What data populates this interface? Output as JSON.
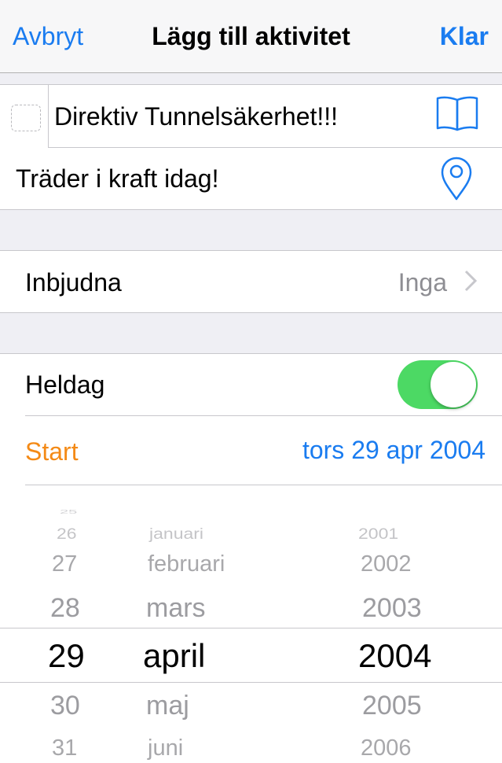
{
  "nav": {
    "cancel": "Avbryt",
    "title": "Lägg till aktivitet",
    "done": "Klar"
  },
  "event": {
    "title": "Direktiv Tunnelsäkerhet!!!",
    "location": "Träder i kraft idag!",
    "icons": [
      "book-icon",
      "location-pin-icon"
    ]
  },
  "invitees": {
    "label": "Inbjudna",
    "value": "Inga"
  },
  "allday": {
    "label": "Heldag",
    "on": true
  },
  "start": {
    "label": "Start",
    "value": "tors 29 apr 2004"
  },
  "picker": {
    "days": [
      "26",
      "27",
      "28",
      "29",
      "30",
      "31"
    ],
    "months": [
      "januari",
      "februari",
      "mars",
      "april",
      "maj",
      "juni"
    ],
    "years": [
      "2001",
      "2002",
      "2003",
      "2004",
      "2005",
      "2006"
    ],
    "selected": {
      "day": "29",
      "month": "april",
      "year": "2004"
    }
  },
  "colors": {
    "accent": "#1a7cf0",
    "start": "#f48a16",
    "toggle_on": "#4cd964"
  }
}
